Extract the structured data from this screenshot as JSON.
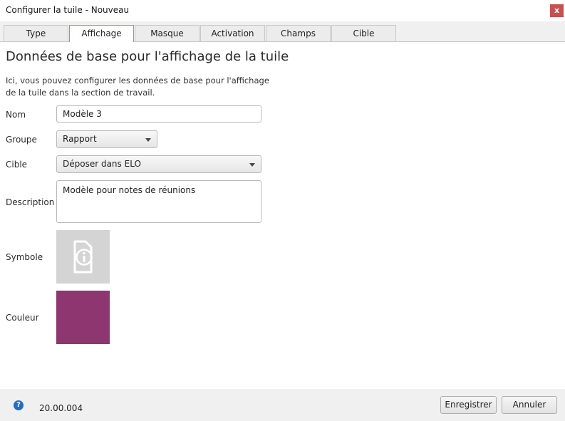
{
  "window": {
    "title": "Configurer la tuile - Nouveau",
    "close_label": "x"
  },
  "tabs": [
    {
      "label": "Type",
      "active": false
    },
    {
      "label": "Affichage",
      "active": true
    },
    {
      "label": "Masque",
      "active": false
    },
    {
      "label": "Activation",
      "active": false
    },
    {
      "label": "Champs",
      "active": false
    },
    {
      "label": "Cible",
      "active": false
    }
  ],
  "main": {
    "heading": "Données de base pour l'affichage de la tuile",
    "intro": "Ici, vous pouvez configurer les données de base pour l'affichage de la tuile dans la section de travail.",
    "fields": {
      "name": {
        "label": "Nom",
        "value": "Modèle 3"
      },
      "group": {
        "label": "Groupe",
        "value": "Rapport"
      },
      "target": {
        "label": "Cible",
        "value": "Déposer dans ELO"
      },
      "description": {
        "label": "Description",
        "value": "Modèle pour notes de réunions"
      },
      "symbol": {
        "label": "Symbole",
        "icon": "document-info-icon"
      },
      "color": {
        "label": "Couleur",
        "value": "#8e3670"
      }
    }
  },
  "footer": {
    "help_label": "?",
    "version": "20.00.004",
    "save_label": "Enregistrer",
    "cancel_label": "Annuler"
  }
}
